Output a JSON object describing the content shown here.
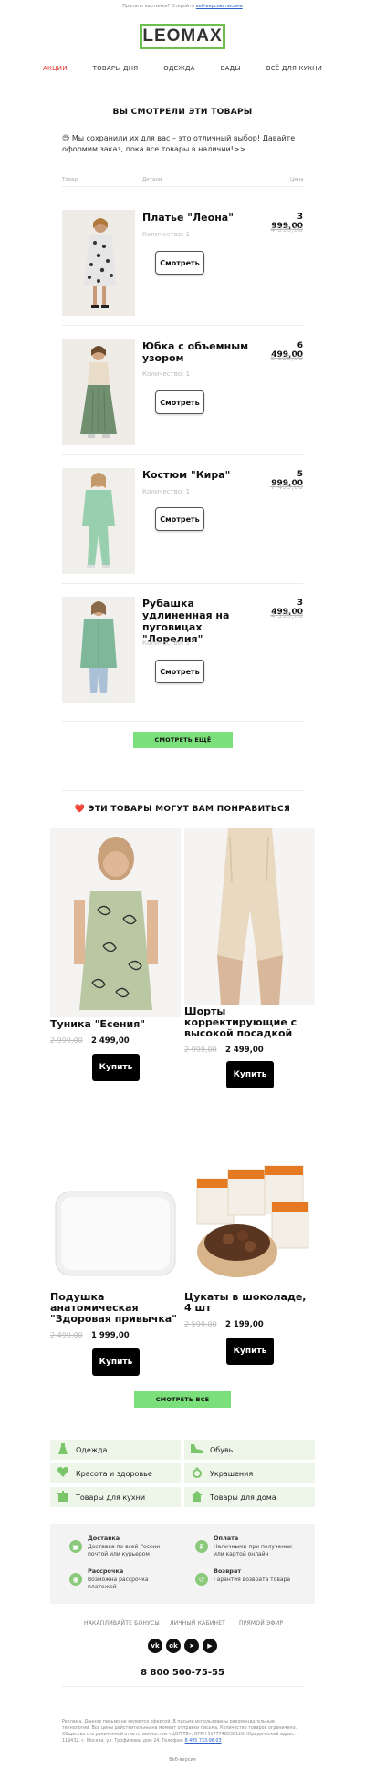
{
  "preheader": {
    "text": "Пропали картинки? Откройте ",
    "link": "веб-версию письма"
  },
  "logo": "LEOMAX",
  "nav": [
    "АКЦИИ",
    "ТОВАРЫ ДНЯ",
    "ОДЕЖДА",
    "БАДЫ",
    "ВСЁ ДЛЯ КУХНИ"
  ],
  "viewed": {
    "title": "ВЫ СМОТРЕЛИ ЭТИ ТОВАРЫ",
    "intro": "😍 Мы сохранили их для вас – это отличный выбор! Давайте оформим заказ, пока все товары в наличии!>>",
    "headers": {
      "product": "Товар",
      "details": "Детали",
      "price": "Цена"
    },
    "items": [
      {
        "name": "Платье \"Леона\"",
        "qty": "Количество: 1",
        "price": "3 999,00",
        "old": "4 999,00",
        "button": "Смотреть"
      },
      {
        "name": "Юбка с объемным узором",
        "qty": "Количество: 1",
        "price": "6 499,00",
        "old": "8 199,00",
        "button": "Смотреть"
      },
      {
        "name": "Костюм \"Кира\"",
        "qty": "Количество: 1",
        "price": "5 999,00",
        "old": "7 499,00",
        "button": "Смотреть"
      },
      {
        "name": "Рубашка удлиненная на пуговицах \"Лорелия\"",
        "qty": "Количество: 1",
        "price": "3 499,00",
        "old": "4 399,00",
        "button": "Смотреть"
      }
    ],
    "more_button": "СМОТРЕТЬ ЕЩЁ"
  },
  "recommend": {
    "title": "❤️ ЭТИ ТОВАРЫ МОГУТ ВАМ ПОНРАВИТЬСЯ",
    "items": [
      {
        "name": "Туника \"Есения\"",
        "old": "2 999,00",
        "price": "2 499,00",
        "button": "Купить"
      },
      {
        "name": "Шорты корректирующие с высокой посадкой",
        "old": "2 999,00",
        "price": "2 499,00",
        "button": "Купить"
      },
      {
        "name": "Подушка анатомическая \"Здоровая привычка\"",
        "old": "2 499,00",
        "price": "1 999,00",
        "button": "Купить"
      },
      {
        "name": "Цукаты в шоколаде, 4 шт",
        "old": "2 599,00",
        "price": "2 199,00",
        "button": "Купить"
      }
    ],
    "all_button": "СМОТРЕТЬ ВСЕ"
  },
  "categories": [
    {
      "label": "Одежда",
      "icon": "dress-icon"
    },
    {
      "label": "Обувь",
      "icon": "shoe-icon"
    },
    {
      "label": "Красота и здоровье",
      "icon": "heart-icon"
    },
    {
      "label": "Украшения",
      "icon": "ring-icon"
    },
    {
      "label": "Товары для кухни",
      "icon": "kitchen-icon"
    },
    {
      "label": "Товары для дома",
      "icon": "house-icon"
    }
  ],
  "services": [
    {
      "title": "Доставка",
      "desc": "Доставка по всей России почтой или курьером",
      "icon": "box-icon"
    },
    {
      "title": "Оплата",
      "desc": "Наличными при получении или картой онлайн",
      "icon": "ruble-icon"
    },
    {
      "title": "Рассрочка",
      "desc": "Возможна рассрочка платежей",
      "icon": "wallet-icon"
    },
    {
      "title": "Возврат",
      "desc": "Гарантия возврата товара",
      "icon": "return-icon"
    }
  ],
  "footer_links": [
    "НАКАПЛИВАЙТЕ БОНУСЫ",
    "ЛИЧНЫЙ КАБИНЕТ",
    "ПРЯМОЙ ЭФИР"
  ],
  "social": [
    "VK",
    "OK",
    "TG",
    "YT"
  ],
  "phone": "8 800 500-75-55",
  "legal": {
    "text": "Реклама. Данное письмо не является офертой. В письме использованы рекомендательные технологии. Все цены действительны на момент отправки письма. Количество товаров ограничено. Общество с ограниченной ответственностью «ЦОП ТВ», ОГРН 5177746036128. Юридический адрес: 119432, г. Москва, ул. Трофимова, дом 24. Телефон: ",
    "phone_link": "8 495 733-96-03"
  },
  "webversion": "Веб-версия",
  "colors": {
    "accent_green": "#7be07b",
    "logo_green": "#6cc04a",
    "nav_red": "#e2342b",
    "category_bg": "#eef5e9"
  }
}
